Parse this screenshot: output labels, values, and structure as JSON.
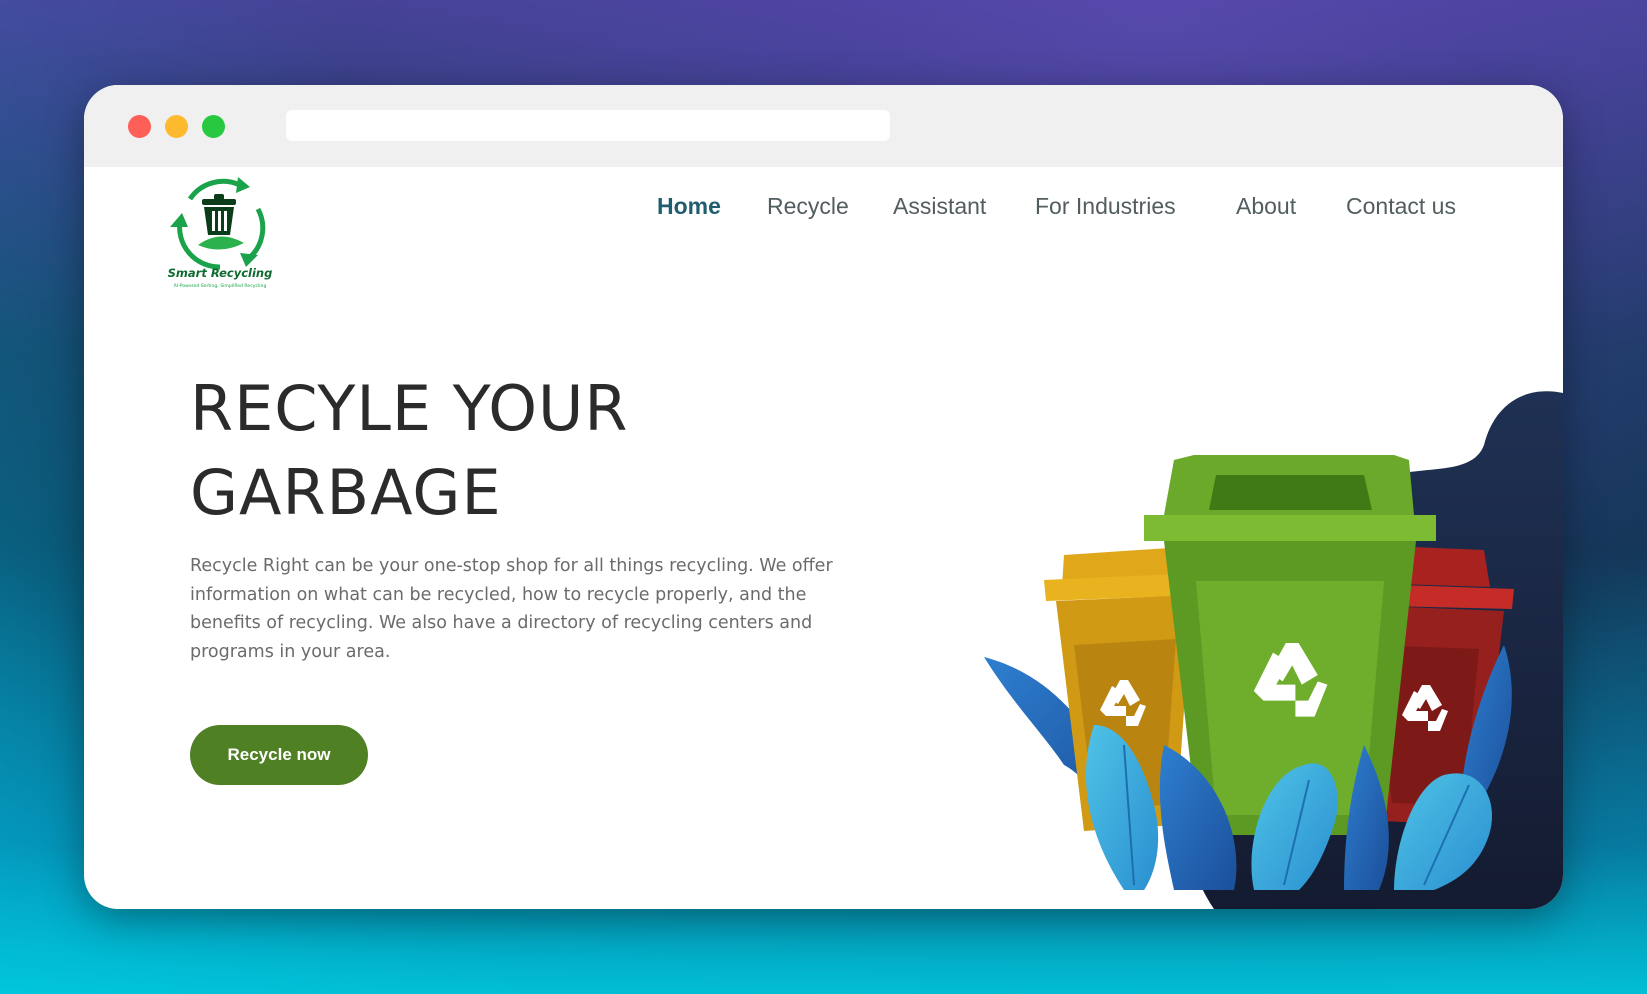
{
  "logo": {
    "name": "Smart Recycling",
    "tagline": "AI-Powered Sorting, Simplified Recycling"
  },
  "nav": {
    "items": [
      {
        "label": "Home",
        "active": true
      },
      {
        "label": "Recycle",
        "active": false
      },
      {
        "label": "Assistant",
        "active": false
      },
      {
        "label": "For Industries",
        "active": false
      },
      {
        "label": "About",
        "active": false
      },
      {
        "label": "Contact us",
        "active": false
      }
    ]
  },
  "hero": {
    "title_line1": "RECYLE YOUR",
    "title_line2": "GARBAGE",
    "description": "Recycle Right can be your one-stop shop for all things recycling. We offer information on what can be recycled, how to recycle properly, and the benefits of recycling. We also have a directory of recycling centers and programs in your area.",
    "cta_label": "Recycle now"
  },
  "colors": {
    "accent": "#4f8024",
    "nav_active": "#1f5e6e",
    "bin_yellow": "#d9a21b",
    "bin_green": "#6aa92a",
    "bin_red": "#a8221f",
    "blob": "#1b2a48"
  }
}
